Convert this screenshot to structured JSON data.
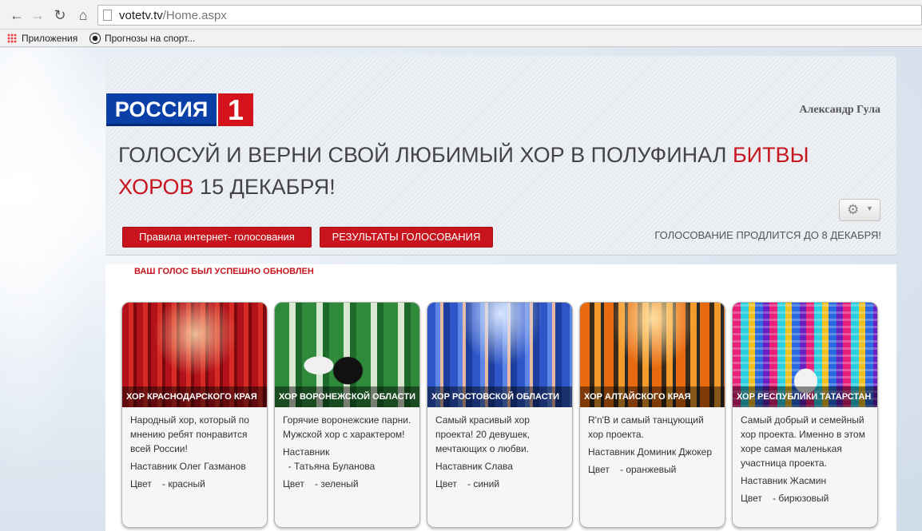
{
  "browser": {
    "url_host": "votetv.tv",
    "url_path": "/Home.aspx",
    "bookmarks": [
      {
        "label": "Приложения",
        "icon": "apps-grid-icon"
      },
      {
        "label": "Прогнозы на спорт...",
        "icon": "soccer-ball-icon"
      }
    ]
  },
  "header": {
    "logo_text": "РОССИЯ",
    "logo_number": "1",
    "username": "Александр Гула",
    "headline_part1": "ГОЛОСУЙ И ВЕРНИ СВОЙ ЛЮБИМЫЙ ХОР В ПОЛУФИНАЛ ",
    "headline_highlight": "БИТВЫ ХОРОВ",
    "headline_part2": " 15 ДЕКАБРЯ!",
    "rules_button": "Правила интернет- голосования",
    "results_button": "РЕЗУЛЬТАТЫ ГОЛОСОВАНИЯ",
    "deadline_text": "ГОЛОСОВАНИЕ ПРОДЛИТСЯ ДО 8 ДЕКАБРЯ!"
  },
  "notice": "ВАШ ГОЛОС БЫЛ УСПЕШНО ОБНОВЛЕН",
  "choirs": [
    {
      "title": "ХОР КРАСНОДАРСКОГО КРАЯ",
      "description": "Народный хор, который по мнению ребят понравится всей России!",
      "mentor": "Наставник Олег Газманов",
      "color_label": "Цвет",
      "color_value": "- красный",
      "accent": "#d62a22"
    },
    {
      "title": "ХОР ВОРОНЕЖСКОЙ ОБЛАСТИ",
      "description": "Горячие воронежские парни. Мужской хор с характером!",
      "mentor_label": "Наставник",
      "mentor_name": "- Татьяна Буланова",
      "color_label": "Цвет",
      "color_value": "- зеленый",
      "accent": "#2f8a3c"
    },
    {
      "title": "ХОР РОСТОВСКОЙ ОБЛАСТИ",
      "description": "Самый красивый хор проекта! 20 девушек, мечтающих о любви.",
      "mentor": "Наставник Слава",
      "color_label": "Цвет",
      "color_value": "- синий",
      "accent": "#2f56c8"
    },
    {
      "title": "ХОР АЛТАЙСКОГО КРАЯ",
      "description": "R'n'B и самый танцующий хор проекта.",
      "mentor": "Наставник Доминик Джокер",
      "color_label": "Цвет",
      "color_value": "- оранжевый",
      "accent": "#e86a10"
    },
    {
      "title": "ХОР РЕСПУБЛИКИ ТАТАРСТАН",
      "description": "Самый добрый и семейный хор проекта. Именно в этом хоре самая маленькая участница проекта.",
      "mentor": "Наставник Жасмин",
      "color_label": "Цвет",
      "color_value": "- бирюзовый",
      "accent": "#2ad0e0"
    }
  ]
}
